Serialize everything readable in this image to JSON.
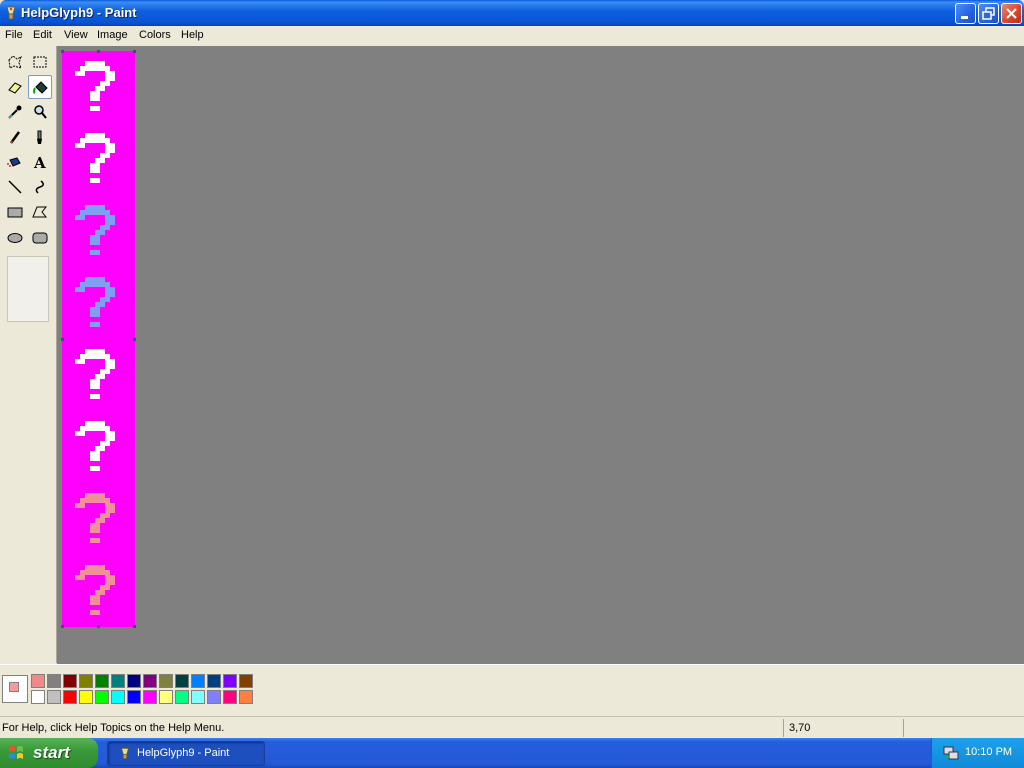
{
  "window": {
    "title": "HelpGlyph9 - Paint"
  },
  "menu": [
    "File",
    "Edit",
    "View",
    "Image",
    "Colors",
    "Help"
  ],
  "toolbox": {
    "tools": [
      "free-form-select",
      "rectangle-select",
      "eraser",
      "fill-with-color",
      "pick-color",
      "magnifier",
      "pencil",
      "brush",
      "airbrush",
      "text",
      "line",
      "curve",
      "rectangle",
      "polygon",
      "ellipse",
      "rounded-rectangle"
    ],
    "selected_tool": "fill-with-color"
  },
  "canvas": {
    "background": "#ff00ff",
    "glyph_colors": [
      "#ffffff",
      "#ffffff",
      "#7f9ff0",
      "#7f9ff0",
      "#ffffff",
      "#ffffff",
      "#f0909a",
      "#f0909a"
    ]
  },
  "palette": {
    "foreground": "#f79a9a",
    "background": "#ffffff",
    "colors_top": [
      "#f08a8a",
      "#808080",
      "#800000",
      "#808000",
      "#008000",
      "#008080",
      "#000080",
      "#800080",
      "#808040",
      "#004040",
      "#0080ff",
      "#004080",
      "#8000ff",
      "#804000"
    ],
    "colors_bottom": [
      "#ffffff",
      "#c0c0c0",
      "#ff0000",
      "#ffff00",
      "#00ff00",
      "#00ffff",
      "#0000ff",
      "#ff00ff",
      "#ffff80",
      "#00ff80",
      "#80ffff",
      "#8080ff",
      "#ff0080",
      "#ff8040"
    ]
  },
  "statusbar": {
    "help_text": "For Help, click Help Topics on the Help Menu.",
    "coords": "3,70"
  },
  "taskbar": {
    "start_label": "start",
    "task_label": "HelpGlyph9 - Paint",
    "clock": "10:10 PM"
  }
}
